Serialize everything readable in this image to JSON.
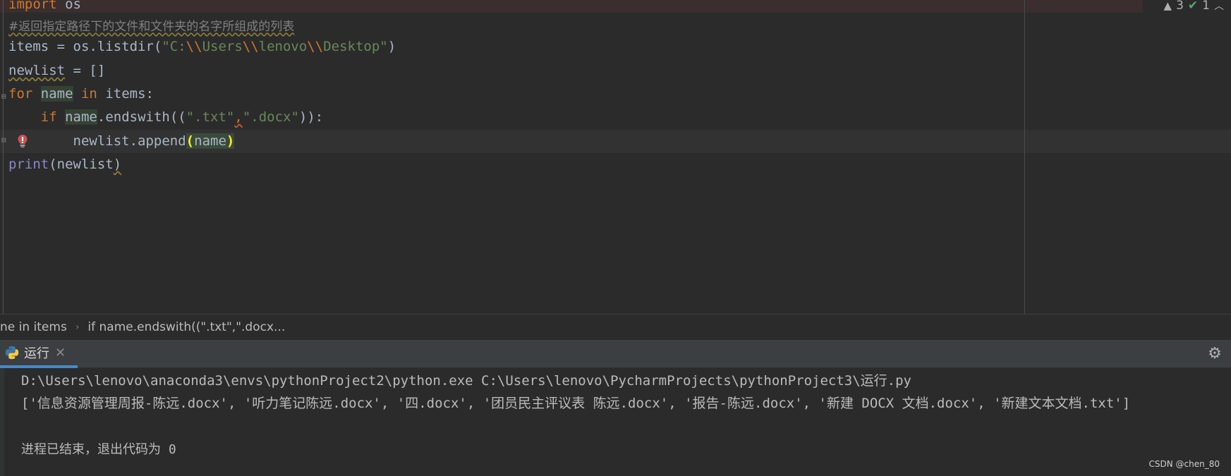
{
  "editor": {
    "inspections": {
      "warnings": "3",
      "ok": "1"
    },
    "lines": {
      "l1_kw": "import",
      "l1_mod": " os",
      "l2_comment": "#返回指定路径下的文件和文件夹的名字所组成的列表",
      "l3_a": "items = os.listdir(",
      "l3_s1": "\"C:",
      "l3_e1": "\\\\",
      "l3_s2": "Users",
      "l3_e2": "\\\\",
      "l3_s3": "lenovo",
      "l3_e3": "\\\\",
      "l3_s4": "Desktop\"",
      "l3_b": ")",
      "l4_var": "newlist",
      "l4_rest": " = []",
      "l5_for": "for",
      "l5_sp1": " ",
      "l5_name": "name",
      "l5_in": " in",
      "l5_rest": " items:",
      "l6_indent": "    ",
      "l6_if": "if",
      "l6_sp": " ",
      "l6_name": "name",
      "l6_mid": ".endswith((",
      "l6_s1": "\".txt\"",
      "l6_comma": ",",
      "l6_s2": "\".docx\"",
      "l6_end": ")):",
      "l7_indent": "        ",
      "l7_a": "newlist.append",
      "l7_open": "(",
      "l7_name": "name",
      "l7_close": ")",
      "l8_print": "print",
      "l8_open": "(",
      "l8_arg": "newlist",
      "l8_close": ")"
    }
  },
  "breadcrumb": {
    "item1": "ne in items",
    "separator": "›",
    "item2": "if name.endswith((\".txt\",\".docx..."
  },
  "run_panel": {
    "tab_label": "运行",
    "close_glyph": "✕",
    "gear_glyph": "⚙"
  },
  "console": {
    "command": "D:\\Users\\lenovo\\anaconda3\\envs\\pythonProject2\\python.exe C:\\Users\\lenovo\\PycharmProjects\\pythonProject3\\运行.py",
    "output": "['信息资源管理周报-陈远.docx', '听力笔记陈远.docx', '四.docx', '团员民主评议表 陈远.docx', '报告-陈远.docx', '新建 DOCX 文档.docx', '新建文本文档.txt']",
    "exit_message": "进程已结束，退出代码为 0"
  },
  "watermark": "CSDN @chen_80",
  "colors": {
    "keyword": "#cc7832",
    "string": "#6a8759",
    "builtin": "#8888c6",
    "comment": "#808080",
    "text": "#a9b7c6",
    "tab_underline": "#4a88c7"
  }
}
